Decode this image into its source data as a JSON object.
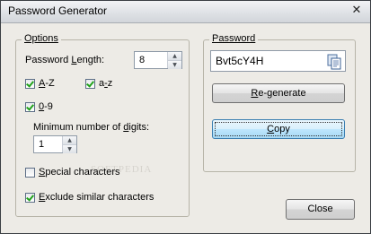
{
  "window": {
    "title": "Password Generator"
  },
  "options": {
    "legend": "Options",
    "password_length": {
      "label_pre": "Password ",
      "label_u": "L",
      "label_post": "ength:",
      "value": "8"
    },
    "az_upper": {
      "label_u": "A",
      "label_post": "-Z",
      "checked": true
    },
    "az_lower": {
      "label_pre": "a",
      "label_u": "-",
      "label_post": "z",
      "checked": true
    },
    "digits": {
      "label_u": "0",
      "label_post": "-9",
      "checked": true
    },
    "min_digits": {
      "label_pre": "Minimum number of ",
      "label_u": "d",
      "label_post": "igits:",
      "value": "1"
    },
    "special": {
      "label_u": "S",
      "label_post": "pecial characters",
      "checked": false
    },
    "exclude_similar": {
      "label_u": "E",
      "label_post": "xclude similar characters",
      "checked": true
    }
  },
  "password": {
    "legend": "Password",
    "value": "Bvt5cY4H",
    "regenerate_pre": "",
    "regenerate_u": "R",
    "regenerate_post": "e-generate",
    "copy_u": "C",
    "copy_post": "opy"
  },
  "close_label": "Close",
  "watermark": "SOFTPEDIA"
}
